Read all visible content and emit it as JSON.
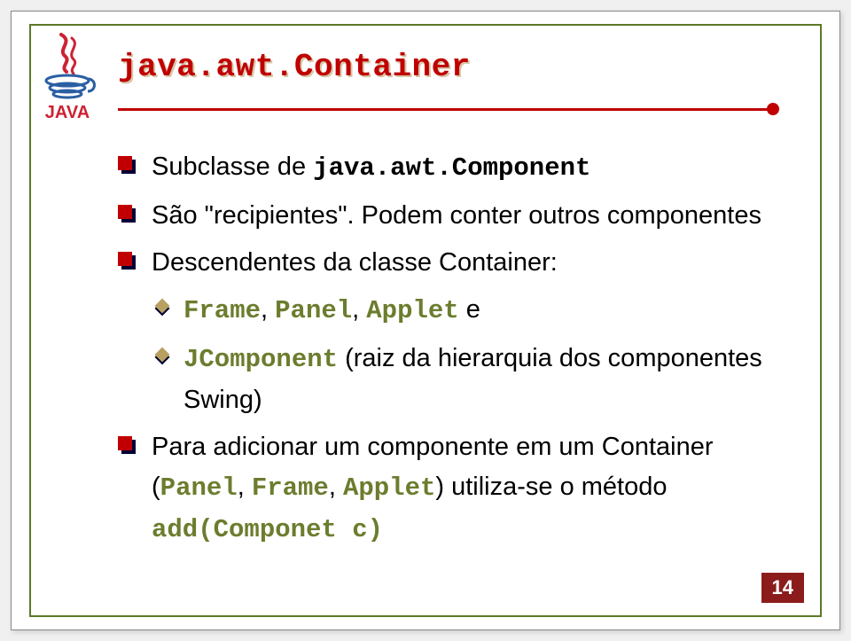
{
  "title": "java.awt.Container",
  "bullets": [
    {
      "prefix": "Subclasse de ",
      "mono": "java.awt.Component",
      "suffix": ""
    },
    {
      "text": "São \"recipientes\". Podem conter outros componentes"
    },
    {
      "text": "Descendentes da classe Container:"
    }
  ],
  "subbullets": [
    {
      "m1": "Frame",
      "c1": ", ",
      "m2": "Panel",
      "c2": ", ",
      "m3": "Applet",
      "suffix": " e"
    },
    {
      "m1": "JComponent",
      "suffix": " (raiz da hierarquia dos componentes Swing)"
    }
  ],
  "bullet4": {
    "prefix": "Para adicionar um componente em um Container (",
    "m1": "Panel",
    "c1": ", ",
    "m2": "Frame",
    "c2": ", ",
    "m3": "Applet",
    "mid": ") utiliza-se o método ",
    "method": "add(Componet c)"
  },
  "pageNumber": "14"
}
